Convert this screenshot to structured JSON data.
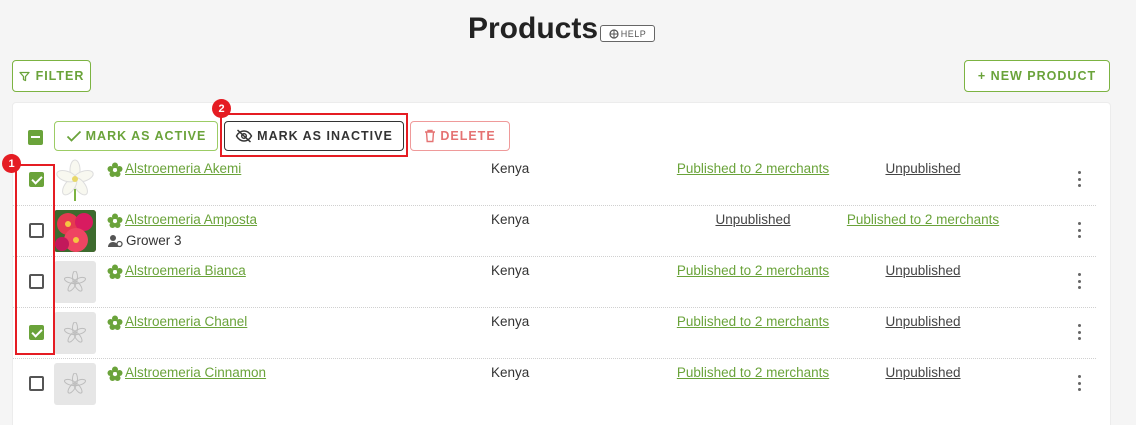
{
  "header": {
    "title": "Products",
    "help_label": "HELP"
  },
  "toolbar": {
    "filter_label": "FILTER",
    "new_product_label": "+ NEW PRODUCT",
    "mark_active_label": "MARK AS ACTIVE",
    "mark_inactive_label": "MARK AS INACTIVE",
    "delete_label": "DELETE"
  },
  "annotations": {
    "first": "1",
    "second": "2"
  },
  "colors": {
    "accent": "#6aa33a",
    "danger": "#e57373",
    "highlight": "#e51c23"
  },
  "products": [
    {
      "name": "Alstroemeria Akemi",
      "checked": true,
      "image": "white-flower",
      "grower": "",
      "origin": "Kenya",
      "status_a": "Published to 2 merchants",
      "status_b": "Unpublished"
    },
    {
      "name": "Alstroemeria Amposta",
      "checked": false,
      "image": "red-flower",
      "grower": "Grower 3",
      "origin": "Kenya",
      "status_a": "Unpublished",
      "status_b": "Published to 2 merchants"
    },
    {
      "name": "Alstroemeria Bianca",
      "checked": false,
      "image": "placeholder",
      "grower": "",
      "origin": "Kenya",
      "status_a": "Published to 2 merchants",
      "status_b": "Unpublished"
    },
    {
      "name": "Alstroemeria Chanel",
      "checked": true,
      "image": "placeholder",
      "grower": "",
      "origin": "Kenya",
      "status_a": "Published to 2 merchants",
      "status_b": "Unpublished"
    },
    {
      "name": "Alstroemeria Cinnamon",
      "checked": false,
      "image": "placeholder",
      "grower": "",
      "origin": "Kenya",
      "status_a": "Published to 2 merchants",
      "status_b": "Unpublished"
    }
  ]
}
